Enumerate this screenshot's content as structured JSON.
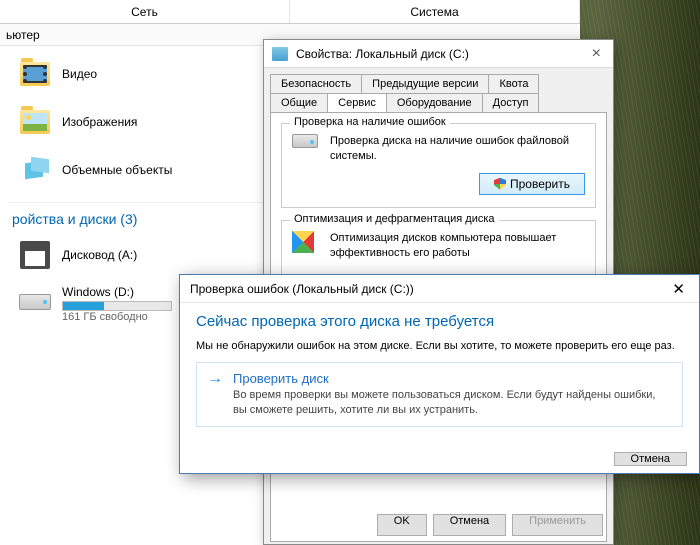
{
  "explorer": {
    "top_tabs": [
      "Сеть",
      "Система"
    ],
    "nav": "ьютер",
    "items": [
      {
        "label": "Видео"
      },
      {
        "label": "Изображения"
      },
      {
        "label": "Объемные объекты"
      }
    ],
    "section": "ройства и диски (3)",
    "drives": [
      {
        "label": "Дисковод (A:)"
      },
      {
        "label": "Windows (D:)",
        "sub": "161 ГБ свободно",
        "fill": 38
      }
    ]
  },
  "props": {
    "title": "Свойства: Локальный диск (C:)",
    "tabs_row1": [
      "Безопасность",
      "Предыдущие версии",
      "Квота"
    ],
    "tabs_row2": [
      "Общие",
      "Сервис",
      "Оборудование",
      "Доступ"
    ],
    "active_tab": "Сервис",
    "group1": {
      "title": "Проверка на наличие ошибок",
      "text": "Проверка диска на наличие ошибок файловой системы.",
      "button": "Проверить"
    },
    "group2": {
      "title": "Оптимизация и дефрагментация диска",
      "text": "Оптимизация дисков компьютера повышает эффективность его работы"
    },
    "buttons": {
      "ok": "OK",
      "cancel": "Отмена",
      "apply": "Применить"
    }
  },
  "check": {
    "title": "Проверка ошибок (Локальный диск (C:))",
    "heading": "Сейчас проверка этого диска не требуется",
    "message": "Мы не обнаружили ошибок на этом диске. Если вы хотите, то можете проверить его еще раз.",
    "option": {
      "title": "Проверить диск",
      "desc": "Во время проверки вы можете пользоваться диском. Если будут найдены ошибки, вы сможете решить, хотите ли вы их устранить."
    },
    "cancel": "Отмена"
  }
}
